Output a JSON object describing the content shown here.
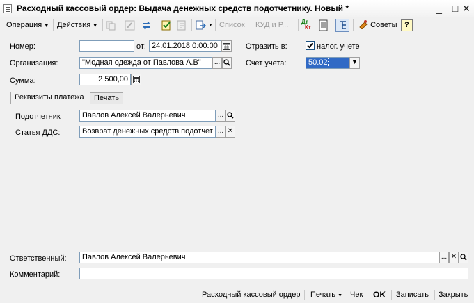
{
  "window": {
    "title": "Расходный кассовый ордер: Выдача денежных средств подотчетнику. Новый *",
    "minimize": "_",
    "maximize": "□",
    "close": "✕"
  },
  "toolbar": {
    "operation": "Операция",
    "actions": "Действия",
    "list": "Список",
    "kud": "КУД и Р...",
    "dtkt_top": "Дт",
    "dtkt_bottom": "Кт",
    "tips": "Советы",
    "help": "?"
  },
  "form": {
    "number_label": "Номер:",
    "number_value": "",
    "from_label": "от:",
    "date_value": "24.01.2018  0:00:00",
    "reflect_label": "Отразить в:",
    "tax_label": "налог. учете",
    "tax_checked": true,
    "org_label": "Организация:",
    "org_value": "\"Модная одежда от Павлова А.В\"",
    "account_label": "Счет учета:",
    "account_value": "50.02",
    "sum_label": "Сумма:",
    "sum_value": "2 500,00"
  },
  "tabs": {
    "payment": "Реквизиты платежа",
    "print": "Печать"
  },
  "payment": {
    "accountable_label": "Подотчетник",
    "accountable_value": "Павлов Алексей Валерьевич",
    "dds_label": "Статья ДДС:",
    "dds_value": "Возврат денежных средств подотчет"
  },
  "footer": {
    "responsible_label": "Ответственный:",
    "responsible_value": "Павлов Алексей Валерьевич",
    "comment_label": "Комментарий:",
    "comment_value": ""
  },
  "bottom": {
    "report": "Расходный кассовый ордер",
    "print": "Печать",
    "check": "Чек",
    "ok": "OK",
    "save": "Записать",
    "close": "Закрыть"
  },
  "controls": {
    "ellipsis": "...",
    "clear": "✕",
    "dropdown": "▼"
  }
}
